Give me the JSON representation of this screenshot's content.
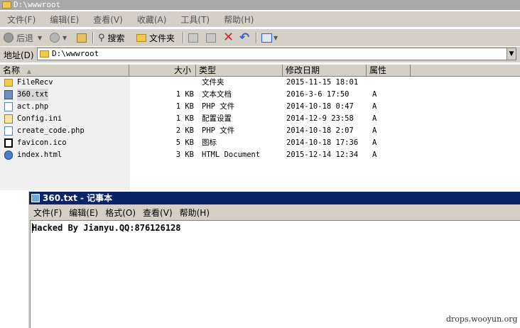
{
  "window": {
    "title": "D:\\wwwroot"
  },
  "menubar": [
    {
      "label": "文件(F)"
    },
    {
      "label": "编辑(E)"
    },
    {
      "label": "查看(V)"
    },
    {
      "label": "收藏(A)"
    },
    {
      "label": "工具(T)"
    },
    {
      "label": "帮助(H)"
    }
  ],
  "toolbar": {
    "back_label": "后退",
    "search_label": "搜索",
    "folders_label": "文件夹"
  },
  "address": {
    "label": "地址(D)",
    "value": "D:\\wwwroot"
  },
  "columns": {
    "name": "名称",
    "size": "大小",
    "type": "类型",
    "modified": "修改日期",
    "attributes": "属性"
  },
  "files": [
    {
      "name": "FileRecv",
      "size": "",
      "type": "文件夹",
      "modified": "2015-11-15 18:01",
      "attr": "",
      "icon": "folder-icon"
    },
    {
      "name": "360.txt",
      "size": "1 KB",
      "type": "文本文档",
      "modified": "2016-3-6 17:50",
      "attr": "A",
      "icon": "text-file-icon"
    },
    {
      "name": "act.php",
      "size": "1 KB",
      "type": "PHP 文件",
      "modified": "2014-10-18 0:47",
      "attr": "A",
      "icon": "php-file-icon"
    },
    {
      "name": "Config.ini",
      "size": "1 KB",
      "type": "配置设置",
      "modified": "2014-12-9 23:58",
      "attr": "A",
      "icon": "ini-file-icon"
    },
    {
      "name": "create_code.php",
      "size": "2 KB",
      "type": "PHP 文件",
      "modified": "2014-10-18 2:07",
      "attr": "A",
      "icon": "php-file-icon"
    },
    {
      "name": "favicon.ico",
      "size": "5 KB",
      "type": "图标",
      "modified": "2014-10-18 17:36",
      "attr": "A",
      "icon": "ico-file-icon"
    },
    {
      "name": "index.html",
      "size": "3 KB",
      "type": "HTML Document",
      "modified": "2015-12-14 12:34",
      "attr": "A",
      "icon": "html-file-icon"
    }
  ],
  "notepad": {
    "title": "360.txt - 记事本",
    "menu": [
      {
        "label": "文件(F)"
      },
      {
        "label": "编辑(E)"
      },
      {
        "label": "格式(O)"
      },
      {
        "label": "查看(V)"
      },
      {
        "label": "帮助(H)"
      }
    ],
    "content": "Hacked By Jianyu.QQ:876126128"
  },
  "watermark": "drops.wooyun.org"
}
